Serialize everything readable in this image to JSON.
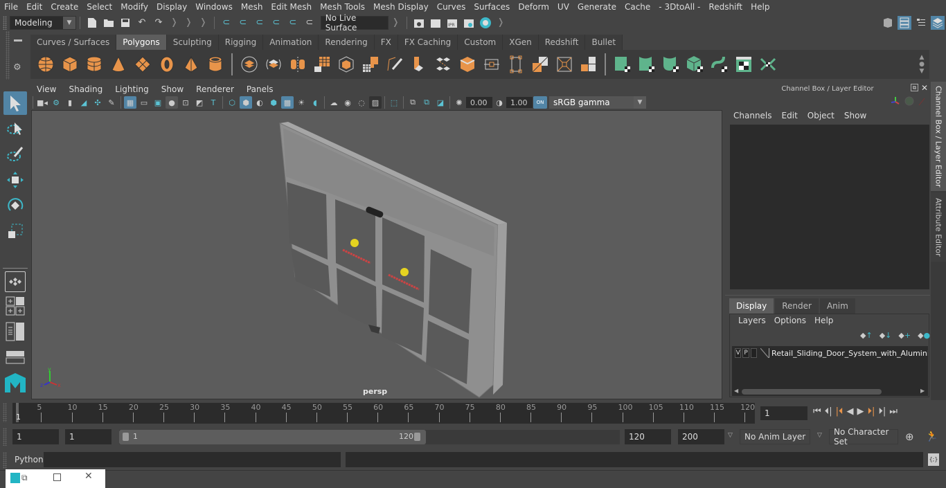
{
  "menubar": {
    "items": [
      "File",
      "Edit",
      "Create",
      "Select",
      "Modify",
      "Display",
      "Windows",
      "Mesh",
      "Edit Mesh",
      "Mesh Tools",
      "Mesh Display",
      "Curves",
      "Surfaces",
      "Deform",
      "UV",
      "Generate",
      "Cache",
      "- 3DtoAll -",
      "Redshift",
      "Help"
    ]
  },
  "statusline": {
    "workspace": "Modeling",
    "live_surface": "No Live Surface"
  },
  "shelf": {
    "tabs": [
      "Curves / Surfaces",
      "Polygons",
      "Sculpting",
      "Rigging",
      "Animation",
      "Rendering",
      "FX",
      "FX Caching",
      "Custom",
      "XGen",
      "Redshift",
      "Bullet"
    ],
    "active_tab": "Polygons",
    "colors": {
      "orange": "#e8944a",
      "green": "#5fb48c",
      "teal": "#3db8c9"
    }
  },
  "viewport": {
    "menu": [
      "View",
      "Shading",
      "Lighting",
      "Show",
      "Renderer",
      "Panels"
    ],
    "exposure": "0.00",
    "gamma": "1.00",
    "color_space": "sRGB gamma",
    "color_mgmt": "ON",
    "camera_label": "persp",
    "axis": {
      "x": "x",
      "y": "y",
      "z": "z"
    }
  },
  "channel_box": {
    "title": "Channel Box / Layer Editor",
    "menu": [
      "Channels",
      "Edit",
      "Object",
      "Show"
    ]
  },
  "layer_editor": {
    "tabs": [
      "Display",
      "Render",
      "Anim"
    ],
    "active_tab": "Display",
    "menu": [
      "Layers",
      "Options",
      "Help"
    ],
    "layers": [
      {
        "v": "V",
        "p": "P",
        "name": "Retail_Sliding_Door_System_with_Aluminium"
      }
    ]
  },
  "side_tabs": [
    "Channel Box / Layer Editor",
    "Attribute Editor"
  ],
  "timeline": {
    "ticks": [
      5,
      10,
      15,
      20,
      25,
      30,
      35,
      40,
      45,
      50,
      55,
      60,
      65,
      70,
      75,
      80,
      85,
      90,
      95,
      100,
      105,
      110,
      115,
      120
    ],
    "current_frame_marker": "1",
    "current_frame": "1"
  },
  "range": {
    "start_time": "1",
    "playback_start": "1",
    "slider_start": "1",
    "slider_end": "120",
    "playback_end": "120",
    "end_time": "200",
    "anim_layer": "No Anim Layer",
    "character_set": "No Character Set"
  },
  "cmdline": {
    "label": "Python"
  }
}
